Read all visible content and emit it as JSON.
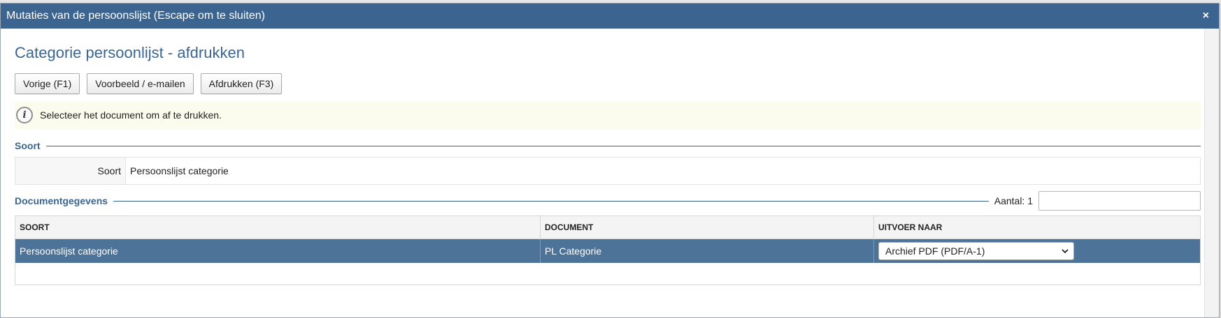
{
  "dialog": {
    "title": "Mutaties van de persoonslijst (Escape om te sluiten)",
    "close_glyph": "×"
  },
  "page": {
    "heading": "Categorie persoonlijst - afdrukken"
  },
  "toolbar": {
    "prev_label": "Vorige (F1)",
    "preview_label": "Voorbeeld / e-mailen",
    "print_label": "Afdrukken (F3)"
  },
  "info": {
    "icon": "info-icon",
    "message": "Selecteer het document om af te drukken."
  },
  "soort_section": {
    "legend": "Soort",
    "field_label": "Soort",
    "field_value": "Persoonslijst categorie"
  },
  "documents": {
    "legend": "Documentgegevens",
    "count_label": "Aantal: 1",
    "filter_value": "",
    "columns": [
      "SOORT",
      "DOCUMENT",
      "UITVOER NAAR"
    ],
    "rows": [
      {
        "soort": "Persoonslijst categorie",
        "document": "PL Categorie",
        "output": "Archief PDF (PDF/A-1)"
      }
    ]
  },
  "colors": {
    "titlebar": "#3b6590",
    "selected_row": "#4d7399",
    "info_bg": "#fcfcee"
  }
}
